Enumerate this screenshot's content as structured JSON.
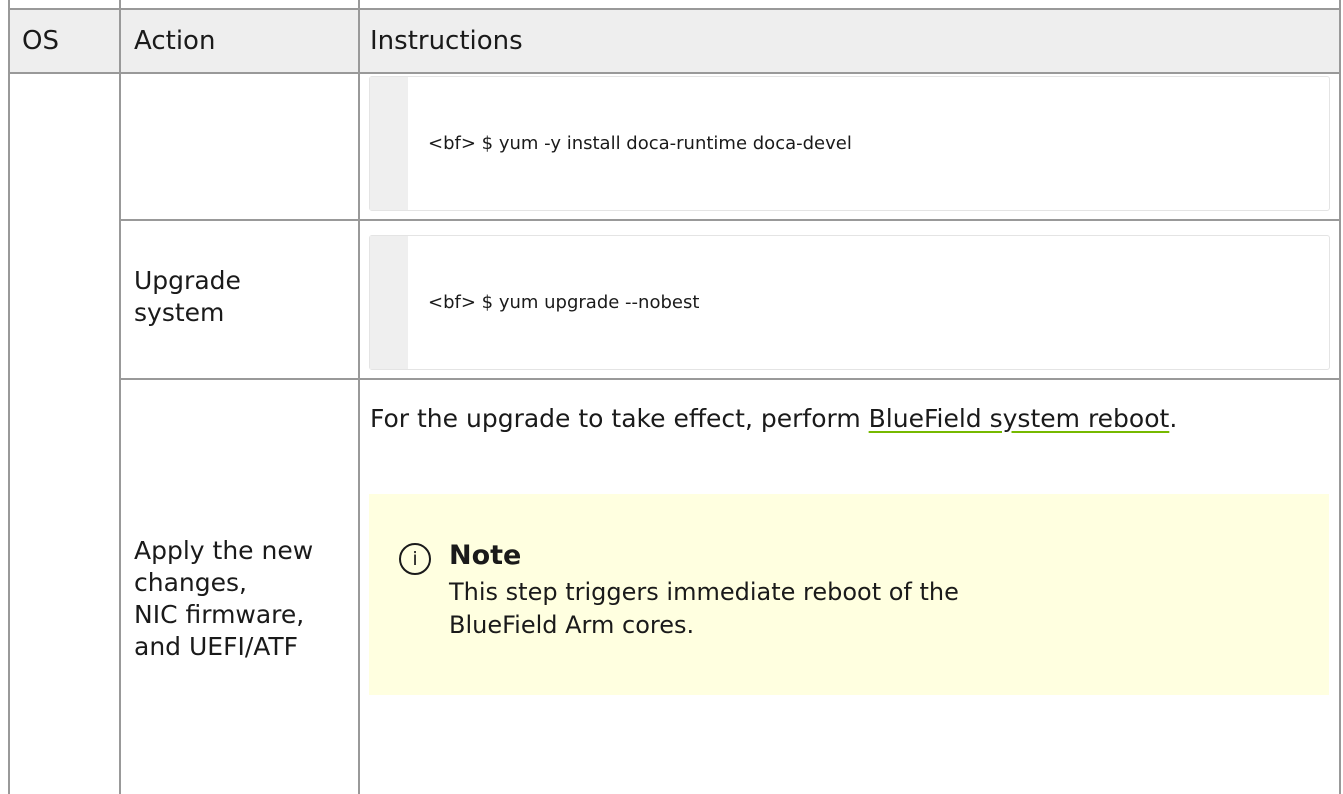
{
  "table": {
    "headers": {
      "os": "OS",
      "action": "Action",
      "instructions": "Instructions"
    },
    "rows": [
      {
        "action": "",
        "code": "<bf> $ yum -y install doca-runtime doca-devel"
      },
      {
        "action_lines": [
          "Upgrade",
          "system"
        ],
        "code": "<bf> $ yum upgrade --nobest"
      },
      {
        "action_lines": [
          "Apply the new",
          "changes,",
          "NIC firmware,",
          "and UEFI/ATF"
        ],
        "text_before": "For the upgrade to take effect, perform ",
        "link_text": "BlueField system reboot",
        "text_after": ".",
        "note": {
          "icon": "info-icon",
          "title": "Note",
          "body_lines": [
            "This step triggers immediate reboot of the",
            "BlueField Arm cores."
          ]
        }
      }
    ]
  },
  "colors": {
    "border": "#999999",
    "header_bg": "#eeeeee",
    "note_bg": "#ffffe0",
    "link_underline": "#76b900"
  }
}
